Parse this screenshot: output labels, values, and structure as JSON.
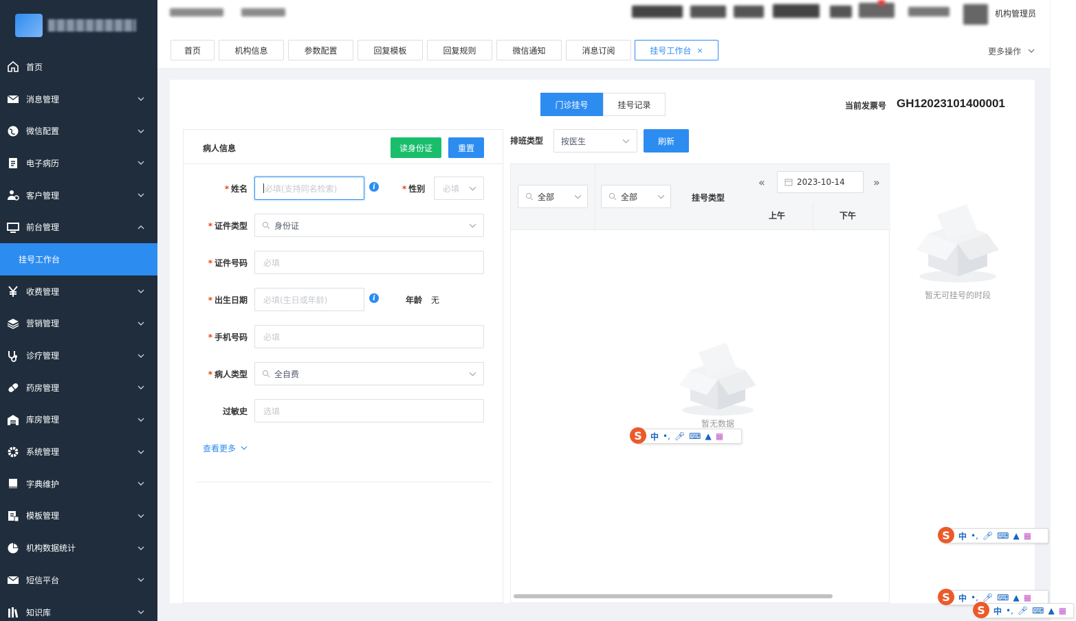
{
  "sidebar": {
    "items": [
      {
        "label": "首页",
        "icon": "home-icon"
      },
      {
        "label": "消息管理",
        "icon": "mail-icon"
      },
      {
        "label": "微信配置",
        "icon": "globe-icon"
      },
      {
        "label": "电子病历",
        "icon": "clipboard-icon"
      },
      {
        "label": "客户管理",
        "icon": "users-icon"
      },
      {
        "label": "前台管理",
        "icon": "monitor-icon"
      },
      {
        "label": "挂号工作台",
        "icon": ""
      },
      {
        "label": "收费管理",
        "icon": "yen-icon"
      },
      {
        "label": "营销管理",
        "icon": "layers-icon"
      },
      {
        "label": "诊疗管理",
        "icon": "stethoscope-icon"
      },
      {
        "label": "药房管理",
        "icon": "pill-icon"
      },
      {
        "label": "库房管理",
        "icon": "warehouse-icon"
      },
      {
        "label": "系统管理",
        "icon": "gear-icon"
      },
      {
        "label": "字典维护",
        "icon": "book-icon"
      },
      {
        "label": "模板管理",
        "icon": "template-icon"
      },
      {
        "label": "机构数据统计",
        "icon": "pie-chart-icon"
      },
      {
        "label": "短信平台",
        "icon": "mail-icon"
      },
      {
        "label": "知识库",
        "icon": "library-icon"
      }
    ]
  },
  "header": {
    "user": "机构管理员"
  },
  "tabs": [
    {
      "label": "首页"
    },
    {
      "label": "机构信息"
    },
    {
      "label": "参数配置"
    },
    {
      "label": "回复模板"
    },
    {
      "label": "回复规则"
    },
    {
      "label": "微信通知"
    },
    {
      "label": "消息订阅"
    },
    {
      "label": "挂号工作台",
      "close": "×"
    }
  ],
  "more_ops": "更多操作",
  "mode_tabs": {
    "outpatient": "门诊挂号",
    "records": "挂号记录"
  },
  "invoice": {
    "label": "当前发票号",
    "value": "GH12023101400001"
  },
  "patient": {
    "title": "病人信息",
    "read_id_btn": "读身份证",
    "reset_btn": "重置",
    "name_label": "姓名",
    "name_placeholder": "必填(支持同名检索)",
    "gender_label": "性别",
    "gender_placeholder": "必填",
    "id_type_label": "证件类型",
    "id_type_value": "身份证",
    "id_no_label": "证件号码",
    "id_no_placeholder": "必填",
    "birth_label": "出生日期",
    "birth_placeholder": "必填(生日或年龄)",
    "age_label": "年龄",
    "age_value": "无",
    "phone_label": "手机号码",
    "phone_placeholder": "必填",
    "ptype_label": "病人类型",
    "ptype_value": "全自费",
    "allergy_label": "过敏史",
    "allergy_placeholder": "选填",
    "see_more": "查看更多"
  },
  "schedule": {
    "type_label": "排班类型",
    "type_value": "按医生",
    "refresh_btn": "刷新",
    "filter1": "全部",
    "filter2": "全部",
    "reg_type_label": "挂号类型",
    "date": "2023-10-14",
    "prev": "«",
    "next": "»",
    "am": "上午",
    "pm": "下午",
    "empty": "暂无数据"
  },
  "side_empty": "暂无可挂号的时段",
  "ime": {
    "s": "S",
    "zh": "中"
  }
}
